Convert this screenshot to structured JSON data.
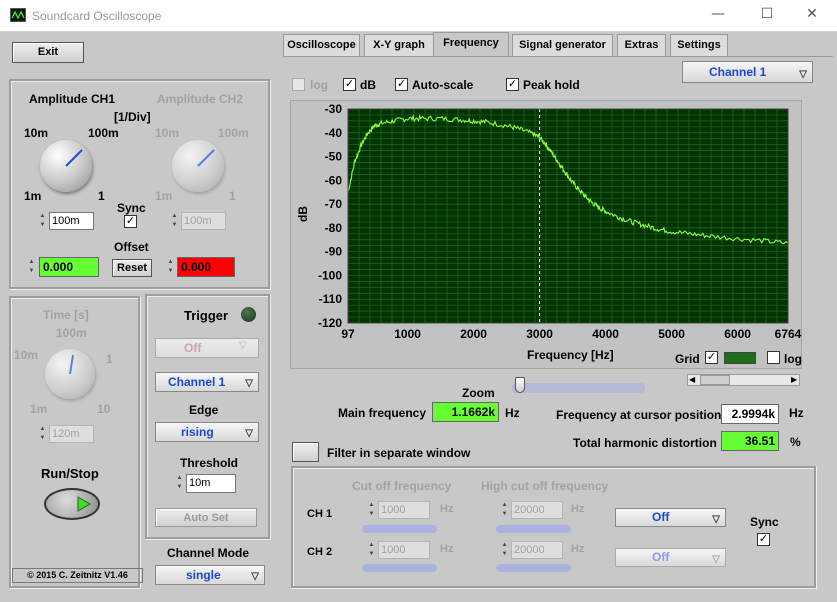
{
  "window": {
    "title": "Soundcard Oscilloscope",
    "minimize": "—",
    "maximize": "☐",
    "close": "✕"
  },
  "exit_label": "Exit",
  "amp_ch1": {
    "title": "Amplitude CH1",
    "units": "[1/Div]",
    "scale": [
      "10m",
      "100m",
      "1m",
      "1"
    ],
    "value": "100m",
    "offset_value": "0.000"
  },
  "amp_ch2": {
    "title": "Amplitude CH2",
    "scale": [
      "10m",
      "100m",
      "1m",
      "1"
    ],
    "value": "100m",
    "offset_value": "0.000"
  },
  "sync_label": "Sync",
  "offset_label": "Offset",
  "reset_label": "Reset",
  "time": {
    "title": "Time [s]",
    "scale": [
      "100m",
      "10m",
      "1",
      "1m",
      "10"
    ],
    "value": "120m"
  },
  "run_stop_label": "Run/Stop",
  "copyright": "© 2015  C. Zeitnitz V1.46",
  "trigger": {
    "title": "Trigger",
    "mode": "Off",
    "channel": "Channel 1",
    "edge_label": "Edge",
    "edge": "rising",
    "threshold_label": "Threshold",
    "threshold": "10m",
    "autoset": "Auto Set"
  },
  "channel_mode": {
    "label": "Channel Mode",
    "value": "single"
  },
  "tabs": [
    "Oscilloscope",
    "X-Y graph",
    "Frequency",
    "Signal generator",
    "Extras",
    "Settings"
  ],
  "freq": {
    "log_label": "log",
    "db_label": "dB",
    "autoscale_label": "Auto-scale",
    "peakhold_label": "Peak hold",
    "channel": "Channel 1",
    "grid_label": "Grid",
    "log2_label": "log",
    "zoom_label": "Zoom",
    "main_freq_label": "Main frequency",
    "main_freq": "1.1662k",
    "hz": "Hz",
    "cursor_label": "Frequency at cursor position",
    "cursor_freq": "2.9994k",
    "thd_label": "Total harmonic distortion",
    "thd": "36.51",
    "pct": "%",
    "filter_label": "Filter in separate window"
  },
  "filter": {
    "cutoff_label": "Cut off frequency",
    "highcut_label": "High cut off frequency",
    "ch1": "CH 1",
    "ch2": "CH 2",
    "ch1_low": "1000",
    "ch1_high": "20000",
    "ch2_low": "1000",
    "ch2_high": "20000",
    "hz": "Hz",
    "ch1_mode": "Off",
    "ch2_mode": "Off",
    "sync_label": "Sync"
  },
  "colors": {
    "plot_bg": "#003300",
    "grid": "#1d6d1d",
    "trace": "#8cff3c",
    "green_display": "#66ff33",
    "red_display": "#ff0000"
  },
  "chart_data": {
    "type": "line",
    "ylabel": "dB",
    "xlabel": "Frequency [Hz]",
    "xlim": [
      97,
      6764
    ],
    "ylim": [
      -120,
      -30
    ],
    "xticks": [
      97,
      1000,
      2000,
      3000,
      4000,
      5000,
      6000,
      6764
    ],
    "yticks": [
      -30,
      -40,
      -50,
      -60,
      -70,
      -80,
      -90,
      -100,
      -110,
      -120
    ],
    "cursor_x": 3000,
    "x": [
      97,
      200,
      300,
      400,
      500,
      600,
      800,
      1000,
      1200,
      1500,
      1800,
      2000,
      2200,
      2500,
      2700,
      2900,
      3000,
      3100,
      3200,
      3300,
      3400,
      3500,
      3600,
      3700,
      3800,
      3900,
      4000,
      4200,
      4400,
      4600,
      4800,
      5000,
      5300,
      5600,
      6000,
      6400,
      6764
    ],
    "y": [
      -65,
      -52,
      -45,
      -40,
      -37,
      -36,
      -35,
      -34,
      -34,
      -34,
      -34.5,
      -35,
      -35.5,
      -37,
      -38.5,
      -40.5,
      -42,
      -45,
      -49,
      -53,
      -57,
      -61,
      -64,
      -67,
      -69.5,
      -71.5,
      -73,
      -75.5,
      -77.5,
      -79,
      -80.5,
      -81.5,
      -82.5,
      -83.5,
      -84.5,
      -85.5,
      -86.5
    ]
  }
}
